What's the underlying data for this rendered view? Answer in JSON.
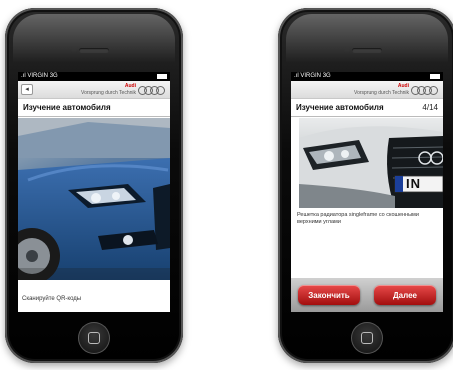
{
  "left_phone": {
    "status": {
      "carrier": "VIRGIN",
      "network": "3G"
    },
    "header": {
      "brand_name": "Audi",
      "slogan": "Vorsprung durch Technik"
    },
    "title": "Изучение автомобиля",
    "caption": "Сканируйте QR-коды"
  },
  "right_phone": {
    "status": {
      "carrier": "VIRGIN",
      "network": "3G"
    },
    "header": {
      "brand_name": "Audi",
      "slogan": "Vorsprung durch Technik"
    },
    "title": "Изучение автомобиля",
    "counter": "4/14",
    "plate_text": "IN",
    "caption": "Решетка радиатора singleframe со скошенными верхними углами",
    "buttons": {
      "finish": "Закончить",
      "next": "Далее"
    }
  },
  "colors": {
    "accent": "#c41212",
    "car_blue": "#1d4c86"
  }
}
